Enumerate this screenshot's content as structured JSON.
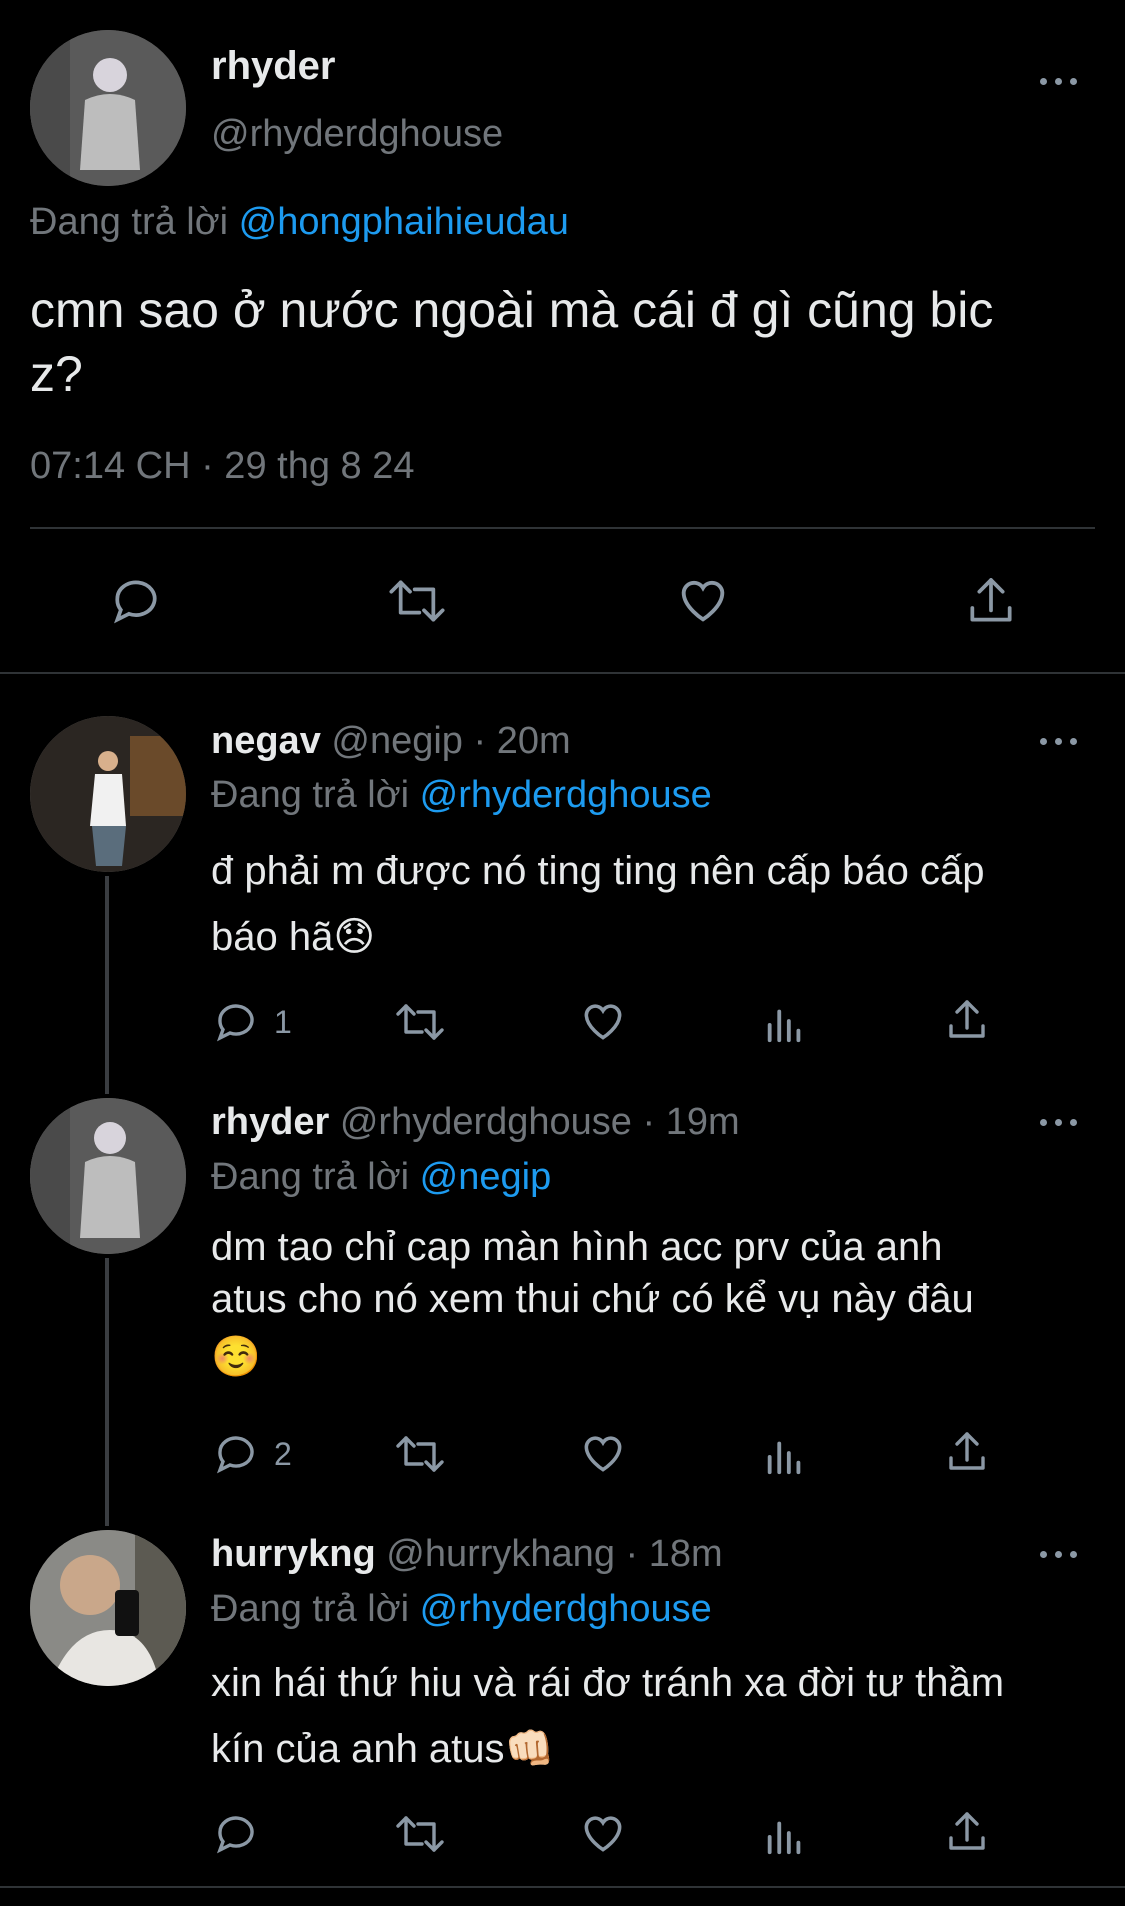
{
  "main_tweet": {
    "name": "rhyder",
    "handle": "@rhyderdghouse",
    "reply_prefix": "Đang trả lời",
    "reply_to": "@hongphaihieudau",
    "text_line1": "cmn sao ở nước ngoài mà cái đ gì cũng bic",
    "text_line2": "z?",
    "timestamp": "07:14 CH · 29 thg 8 24"
  },
  "replies": [
    {
      "name": "negav",
      "meta": "@negip · 20m",
      "reply_prefix": "Đang trả lời",
      "reply_to": "@rhyderdghouse",
      "line1": "đ phải m được nó ting ting nên cấp báo cấp",
      "line2": "báo hã",
      "emoji": "😞",
      "reply_count": "1"
    },
    {
      "name": "rhyder",
      "meta": "@rhyderdghouse · 19m",
      "reply_prefix": "Đang trả lời",
      "reply_to": "@negip",
      "line1": "dm tao chỉ cap màn hình acc prv của anh",
      "line2": "atus cho nó xem thui chứ có kể vụ này đâu",
      "emoji": "☺️",
      "reply_count": "2"
    },
    {
      "name": "hurrykng",
      "meta": "@hurrykhang · 18m",
      "reply_prefix": "Đang trả lời",
      "reply_to": "@rhyderdghouse",
      "line1": "xin hái thứ hiu và rái đơ tránh xa đời tư thầm",
      "line2": "kín của anh atus",
      "emoji": "👊🏻",
      "reply_count": ""
    }
  ],
  "icons": {
    "reply": "reply-icon",
    "retweet": "retweet-icon",
    "like": "heart-icon",
    "views": "views-icon",
    "share": "share-icon",
    "more": "more-icon"
  },
  "colors": {
    "background": "#000000",
    "text": "#e7e9ea",
    "secondary": "#71767b",
    "link": "#1d9bf0",
    "divider": "#2f3336"
  }
}
